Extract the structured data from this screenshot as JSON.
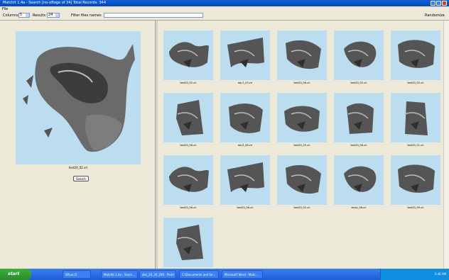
{
  "window": {
    "title": "Matchit 1.4a - Search    [no-oftage of 34]    Total Records: 344",
    "menu": "File"
  },
  "toolbar": {
    "columns_label": "Columns",
    "columns_value": "5",
    "results_label": "Results",
    "results_value": "24",
    "filter_label": "Filter files names",
    "right_label": "Randomize"
  },
  "preview": {
    "caption": "test20_02.vrl",
    "search_button": "Search"
  },
  "results": {
    "thumbnails": [
      {
        "caption": "test20_02.vrl"
      },
      {
        "caption": "doc7_03.vrl"
      },
      {
        "caption": "test20_06.vrl"
      },
      {
        "caption": "test20_02.vrl"
      },
      {
        "caption": "test20_02.vrl"
      },
      {
        "caption": "test20_06.vrl"
      },
      {
        "caption": "doc3_06.vrl"
      },
      {
        "caption": "test20_25.vrl"
      },
      {
        "caption": "test20_06.vrl"
      },
      {
        "caption": "test20_21.vrl"
      },
      {
        "caption": "test20_06.vrl"
      },
      {
        "caption": "test20_06.vrl"
      },
      {
        "caption": "test20_02.vrl"
      },
      {
        "caption": "tessx_06.vrl"
      },
      {
        "caption": "test20_09.vrl"
      },
      {
        "caption": "test20_06.vrl"
      }
    ]
  },
  "taskbar": {
    "start": "start",
    "items": [
      {
        "label": "SPLas D"
      },
      {
        "label": "Matchit 1.4a - Searc..."
      },
      {
        "label": "doc_20_34_200 - Paint"
      },
      {
        "label": "C:\\Documents and Se..."
      },
      {
        "label": "Microsoft Word - Matc..."
      }
    ],
    "clock": "3:46 AM"
  },
  "colors": {
    "thumb_bg": "#bcdcf0",
    "titlebar": "#0a5fd8",
    "taskbar": "#2a6ce6",
    "start": "#3fae3f"
  }
}
